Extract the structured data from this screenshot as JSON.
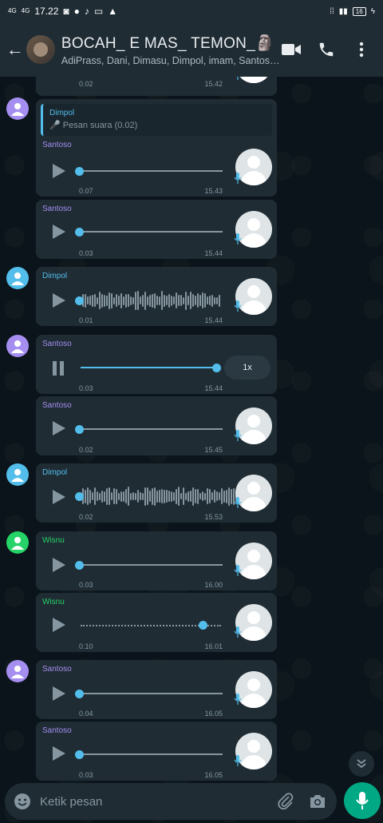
{
  "status_bar": {
    "time": "17.22",
    "net1": "4G",
    "net2": "4G",
    "battery": "16"
  },
  "header": {
    "title": "BOCAH_ E MAS_ TEMON_🗿",
    "subtitle": "AdiPrass, Dani, Dimasu, Dimpol, imam, Santoso, Wisnu"
  },
  "colors": {
    "santoso": "#a58ef0",
    "dimpol": "#53bdeb",
    "wisnu": "#25d366",
    "accent": "#00a884"
  },
  "messages": [
    {
      "duration": "0.02",
      "time": "15.42"
    },
    {
      "sender": "Santoso",
      "quote_name": "Dimpol",
      "quote_text": "Pesan suara (0.02)",
      "duration": "0.07",
      "time": "15.43"
    },
    {
      "sender": "Santoso",
      "duration": "0.03",
      "time": "15.44"
    },
    {
      "sender": "Dimpol",
      "duration": "0.01",
      "time": "15.44"
    },
    {
      "sender": "Santoso",
      "duration": "0.03",
      "time": "15.44",
      "speed": "1x"
    },
    {
      "sender": "Santoso",
      "duration": "0.02",
      "time": "15.45"
    },
    {
      "sender": "Dimpol",
      "duration": "0.02",
      "time": "15.53"
    },
    {
      "sender": "Wisnu",
      "duration": "0.03",
      "time": "16.00"
    },
    {
      "sender": "Wisnu",
      "duration": "0.10",
      "time": "16.01"
    },
    {
      "sender": "Santoso",
      "duration": "0.04",
      "time": "16.05"
    },
    {
      "sender": "Santoso",
      "duration": "0.03",
      "time": "16.05"
    }
  ],
  "input": {
    "placeholder": "Ketik pesan"
  }
}
